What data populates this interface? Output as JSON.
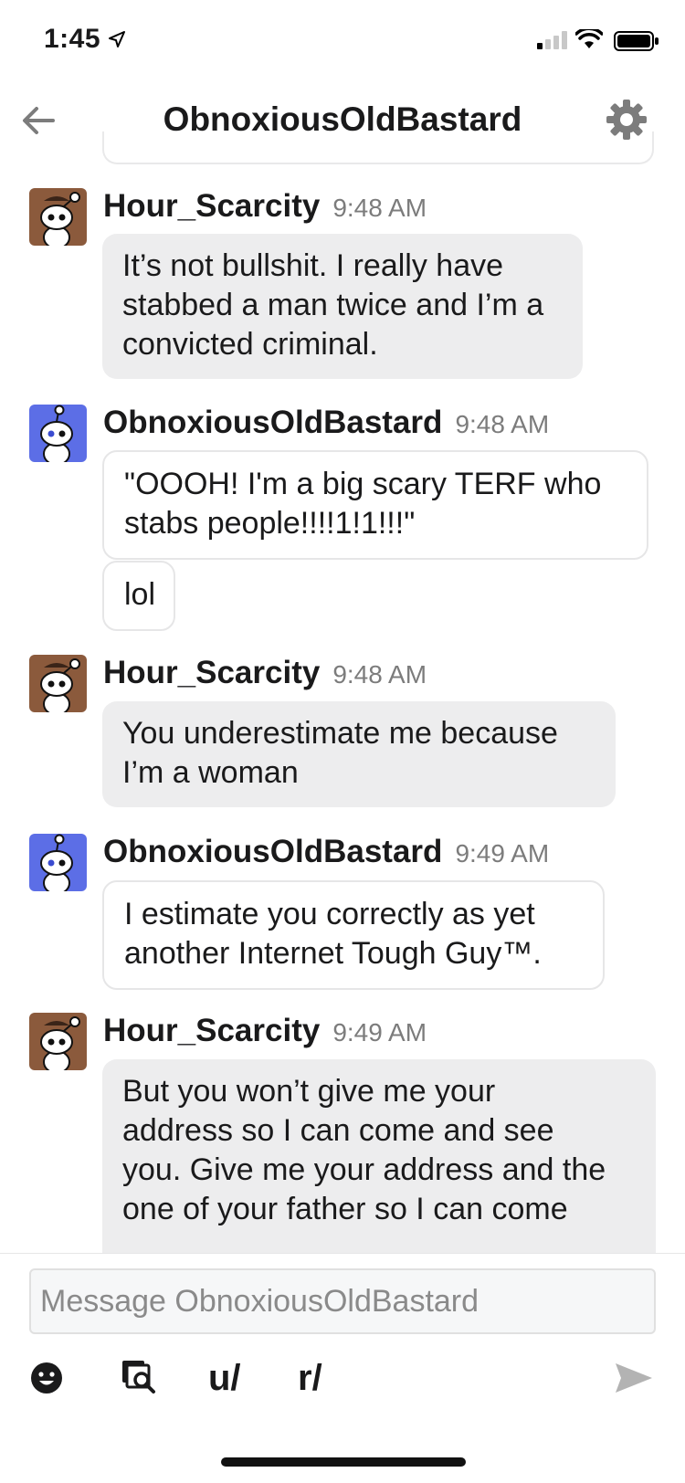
{
  "status_bar": {
    "time": "1:45"
  },
  "header": {
    "title": "ObnoxiousOldBastard"
  },
  "messages": [
    {
      "author": "Hour_Scarcity",
      "time": "9:48 AM",
      "texts": [
        "It’s not bullshit. I really have",
        "stabbed a man twice and I’m a",
        "convicted criminal."
      ]
    },
    {
      "author": "ObnoxiousOldBastard",
      "time": "9:48 AM",
      "texts": [
        "\"OOOH! I'm a big scary TERF who",
        "stabs people!!!!1!1!!!\""
      ],
      "text2": "lol"
    },
    {
      "author": "Hour_Scarcity",
      "time": "9:48 AM",
      "texts": [
        "You underestimate me because",
        "I’m a woman"
      ]
    },
    {
      "author": "ObnoxiousOldBastard",
      "time": "9:49 AM",
      "texts": [
        "I estimate you correctly as yet",
        "another Internet Tough Guy™."
      ]
    },
    {
      "author": "Hour_Scarcity",
      "time": "9:49 AM",
      "texts": [
        "But you won’t give me your",
        "address so I can come and see",
        "you. Give me your address and the",
        "one of your father so I can come"
      ]
    }
  ],
  "composer": {
    "placeholder": "Message ObnoxiousOldBastard",
    "user_label": "u/",
    "subreddit_label": "r/"
  },
  "colors": {
    "theirs_bubble": "#ededee",
    "mine_border": "#e6e6e7",
    "avatar_brown": "#8b5a3c",
    "avatar_blue": "#5c6ee6"
  }
}
